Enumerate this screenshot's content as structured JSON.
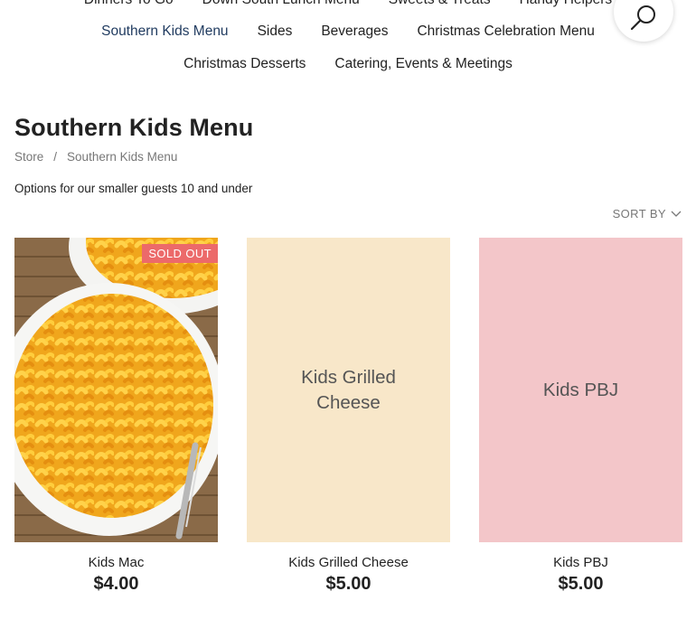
{
  "nav": {
    "row0": [
      "Dinners To Go",
      "Down South Lunch Menu",
      "Sweets & Treats",
      "Handy Helpers"
    ],
    "row1": [
      "Southern Kids Menu",
      "Sides",
      "Beverages",
      "Christmas Celebration Menu"
    ],
    "row2": [
      "Christmas Desserts",
      "Catering, Events & Meetings"
    ],
    "active": "Southern Kids Menu"
  },
  "search": {
    "icon": "search-icon"
  },
  "page": {
    "title": "Southern Kids Menu",
    "description": "Options for our smaller guests 10 and under"
  },
  "breadcrumb": {
    "items": [
      "Store",
      "Southern Kids Menu"
    ],
    "separator": "/"
  },
  "sort": {
    "label": "SORT BY",
    "icon": "chevron-down-icon"
  },
  "products": [
    {
      "name": "Kids Mac",
      "price": "$4.00",
      "badge": "SOLD OUT",
      "image": "mac-and-cheese-photo",
      "placeholder_text": "",
      "bg": "#f2b92c"
    },
    {
      "name": "Kids Grilled Cheese",
      "price": "$5.00",
      "badge": "",
      "image": "placeholder",
      "placeholder_text": "Kids Grilled Cheese",
      "bg": "#f8e7c9"
    },
    {
      "name": "Kids PBJ",
      "price": "$5.00",
      "badge": "",
      "image": "placeholder",
      "placeholder_text": "Kids PBJ",
      "bg": "#f3c6c9"
    }
  ],
  "colors": {
    "active_nav": "#1f3a5f",
    "badge": "#ec6a6a",
    "muted": "#777777"
  }
}
